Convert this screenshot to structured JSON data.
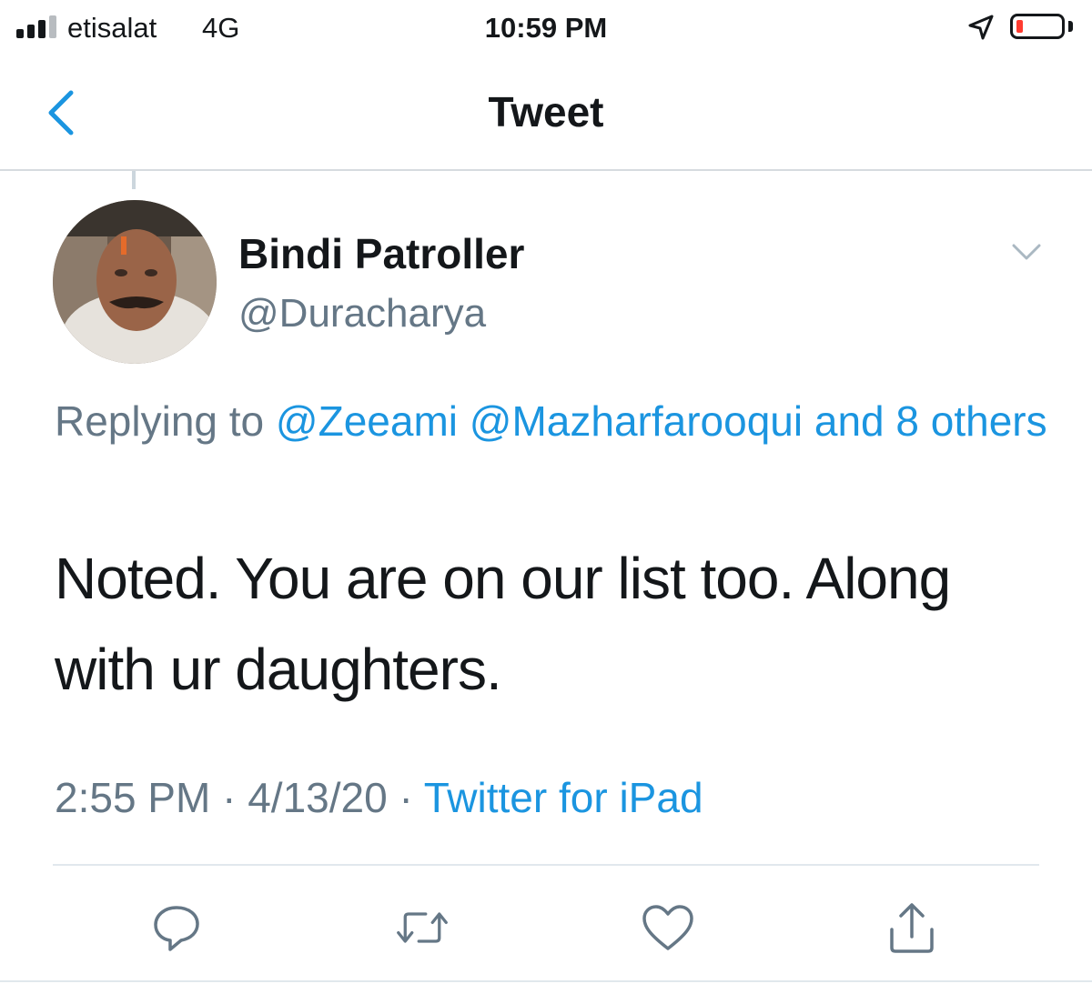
{
  "status_bar": {
    "carrier": "etisalat",
    "network": "4G",
    "time": "10:59 PM",
    "signal_bars": 3,
    "battery_level": 0.15,
    "battery_color": "#ff3b30",
    "icons": [
      "signal-icon",
      "location-icon",
      "battery-icon"
    ]
  },
  "nav": {
    "title": "Tweet",
    "back_icon": "chevron-left-icon",
    "accent": "#1b95e0"
  },
  "tweet": {
    "display_name": "Bindi Patroller",
    "username": "@Duracharya",
    "avatar": "avatar",
    "reply_prefix": "Replying to",
    "reply_mentions": "@Zeeami @Mazharfarooqui and 8 others",
    "text": "Noted. You are on our list too. Along with ur daughters.",
    "time": "2:55 PM",
    "date": "4/13/20",
    "source": "Twitter for iPad",
    "separator": "·"
  },
  "actions": [
    {
      "name": "reply-button",
      "icon": "reply-icon"
    },
    {
      "name": "retweet-button",
      "icon": "retweet-icon"
    },
    {
      "name": "like-button",
      "icon": "heart-icon"
    },
    {
      "name": "share-button",
      "icon": "share-icon"
    }
  ],
  "colors": {
    "primary_text": "#14171a",
    "secondary_text": "#657786",
    "link": "#1b95e0",
    "divider": "#e1e8ed"
  }
}
